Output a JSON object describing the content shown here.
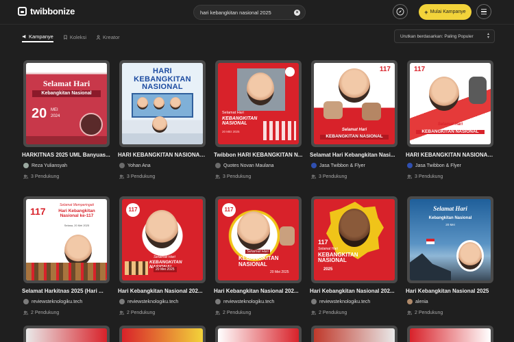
{
  "app": {
    "name": "twibbonize"
  },
  "search": {
    "value": "hari kebangkitan nasional 2025"
  },
  "header": {
    "start_campaign": "Mulai Kampanye"
  },
  "tabs": [
    {
      "label": "Kampanye",
      "active": true
    },
    {
      "label": "Koleksi",
      "active": false
    },
    {
      "label": "Kreator",
      "active": false
    }
  ],
  "sort": {
    "label": "Urutkan berdasarkan",
    "value": "Paling Populer"
  },
  "campaigns": [
    {
      "title": "HARKITNAS 2025 UML Banyuas...",
      "author": "Reza Yuliansyah",
      "supporters": "3 Pendukung",
      "art": {
        "heading": "Selamat Hari",
        "sub": "Kebangkitan Nasional",
        "date_day": "20",
        "date_month": "MEI",
        "date_year": "2024"
      }
    },
    {
      "title": "HARI KEBANGKITAN NASIONAL ...",
      "author": "Yohan Ana",
      "supporters": "3 Pendukung",
      "art": {
        "heading": "HARI KEBANGKITAN NASIONAL"
      }
    },
    {
      "title": "Twibbon HARI KEBANGKITAN N...",
      "author": "Quotes Novan Maulana",
      "supporters": "3 Pendukung",
      "art": {
        "heading": "Selamat Hari",
        "sub": "KEBANGKITAN NASIONAL",
        "date": "20 MEI 2025"
      }
    },
    {
      "title": "Selamat Hari Kebangkitan Nasi...",
      "author": "Jasa Twibbon & Flyer",
      "supporters": "3 Pendukung",
      "art": {
        "badge": "117",
        "heading": "Selamat Hari",
        "sub": "KEBANGKITAN NASIONAL"
      }
    },
    {
      "title": "HARI KEBANGKITAN NASIONAL ...",
      "author": "Jasa Twibbon & Flyer",
      "supporters": "3 Pendukung",
      "art": {
        "badge": "117",
        "heading": "Selamat Hari",
        "sub": "KEBANGKITAN NASIONAL"
      }
    },
    {
      "title": "Selamat Harkitnas 2025 (Hari ...",
      "author": "reviewsteknologiku.tech",
      "supporters": "2 Pendukung",
      "art": {
        "badge": "117",
        "heading": "Selamat Memperingati",
        "sub": "Hari Kebangkitan Nasional ke-117",
        "date": "Selasa, 20 Mei 2025"
      }
    },
    {
      "title": "Hari Kebangkitan Nasional 202...",
      "author": "reviewsteknologiku.tech",
      "supporters": "2 Pendukung",
      "art": {
        "badge": "117",
        "heading": "Selamat Hari",
        "sub": "KEBANGKITAN NASIONAL",
        "date": "20 Mei 2025"
      }
    },
    {
      "title": "Hari Kebangkitan Nasional 202...",
      "author": "reviewsteknologiku.tech",
      "supporters": "2 Pendukung",
      "art": {
        "badge": "117",
        "heading": "Selamat Hari",
        "sub": "KEBANGKITAN NASIONAL",
        "date": "20 Mei 2025"
      }
    },
    {
      "title": "Hari Kebangkitan Nasional 202...",
      "author": "reviewsteknologiku.tech",
      "supporters": "2 Pendukung",
      "art": {
        "badge": "117",
        "heading": "Selamat Hari",
        "sub": "KEBANGKITAN NASIONAL",
        "year": "2025"
      }
    },
    {
      "title": "Hari Kebangkitan Nasional 2025",
      "author": "alenia",
      "supporters": "2 Pendukung",
      "art": {
        "heading": "Selamat Hari",
        "sub": "Kebangkitan Nasional",
        "date": "20 Mei"
      }
    }
  ],
  "colors": {
    "accent": "#f2d33a",
    "background": "#1f1f1f",
    "card_frame": "#4a4a4a",
    "red": "#d8222a"
  }
}
